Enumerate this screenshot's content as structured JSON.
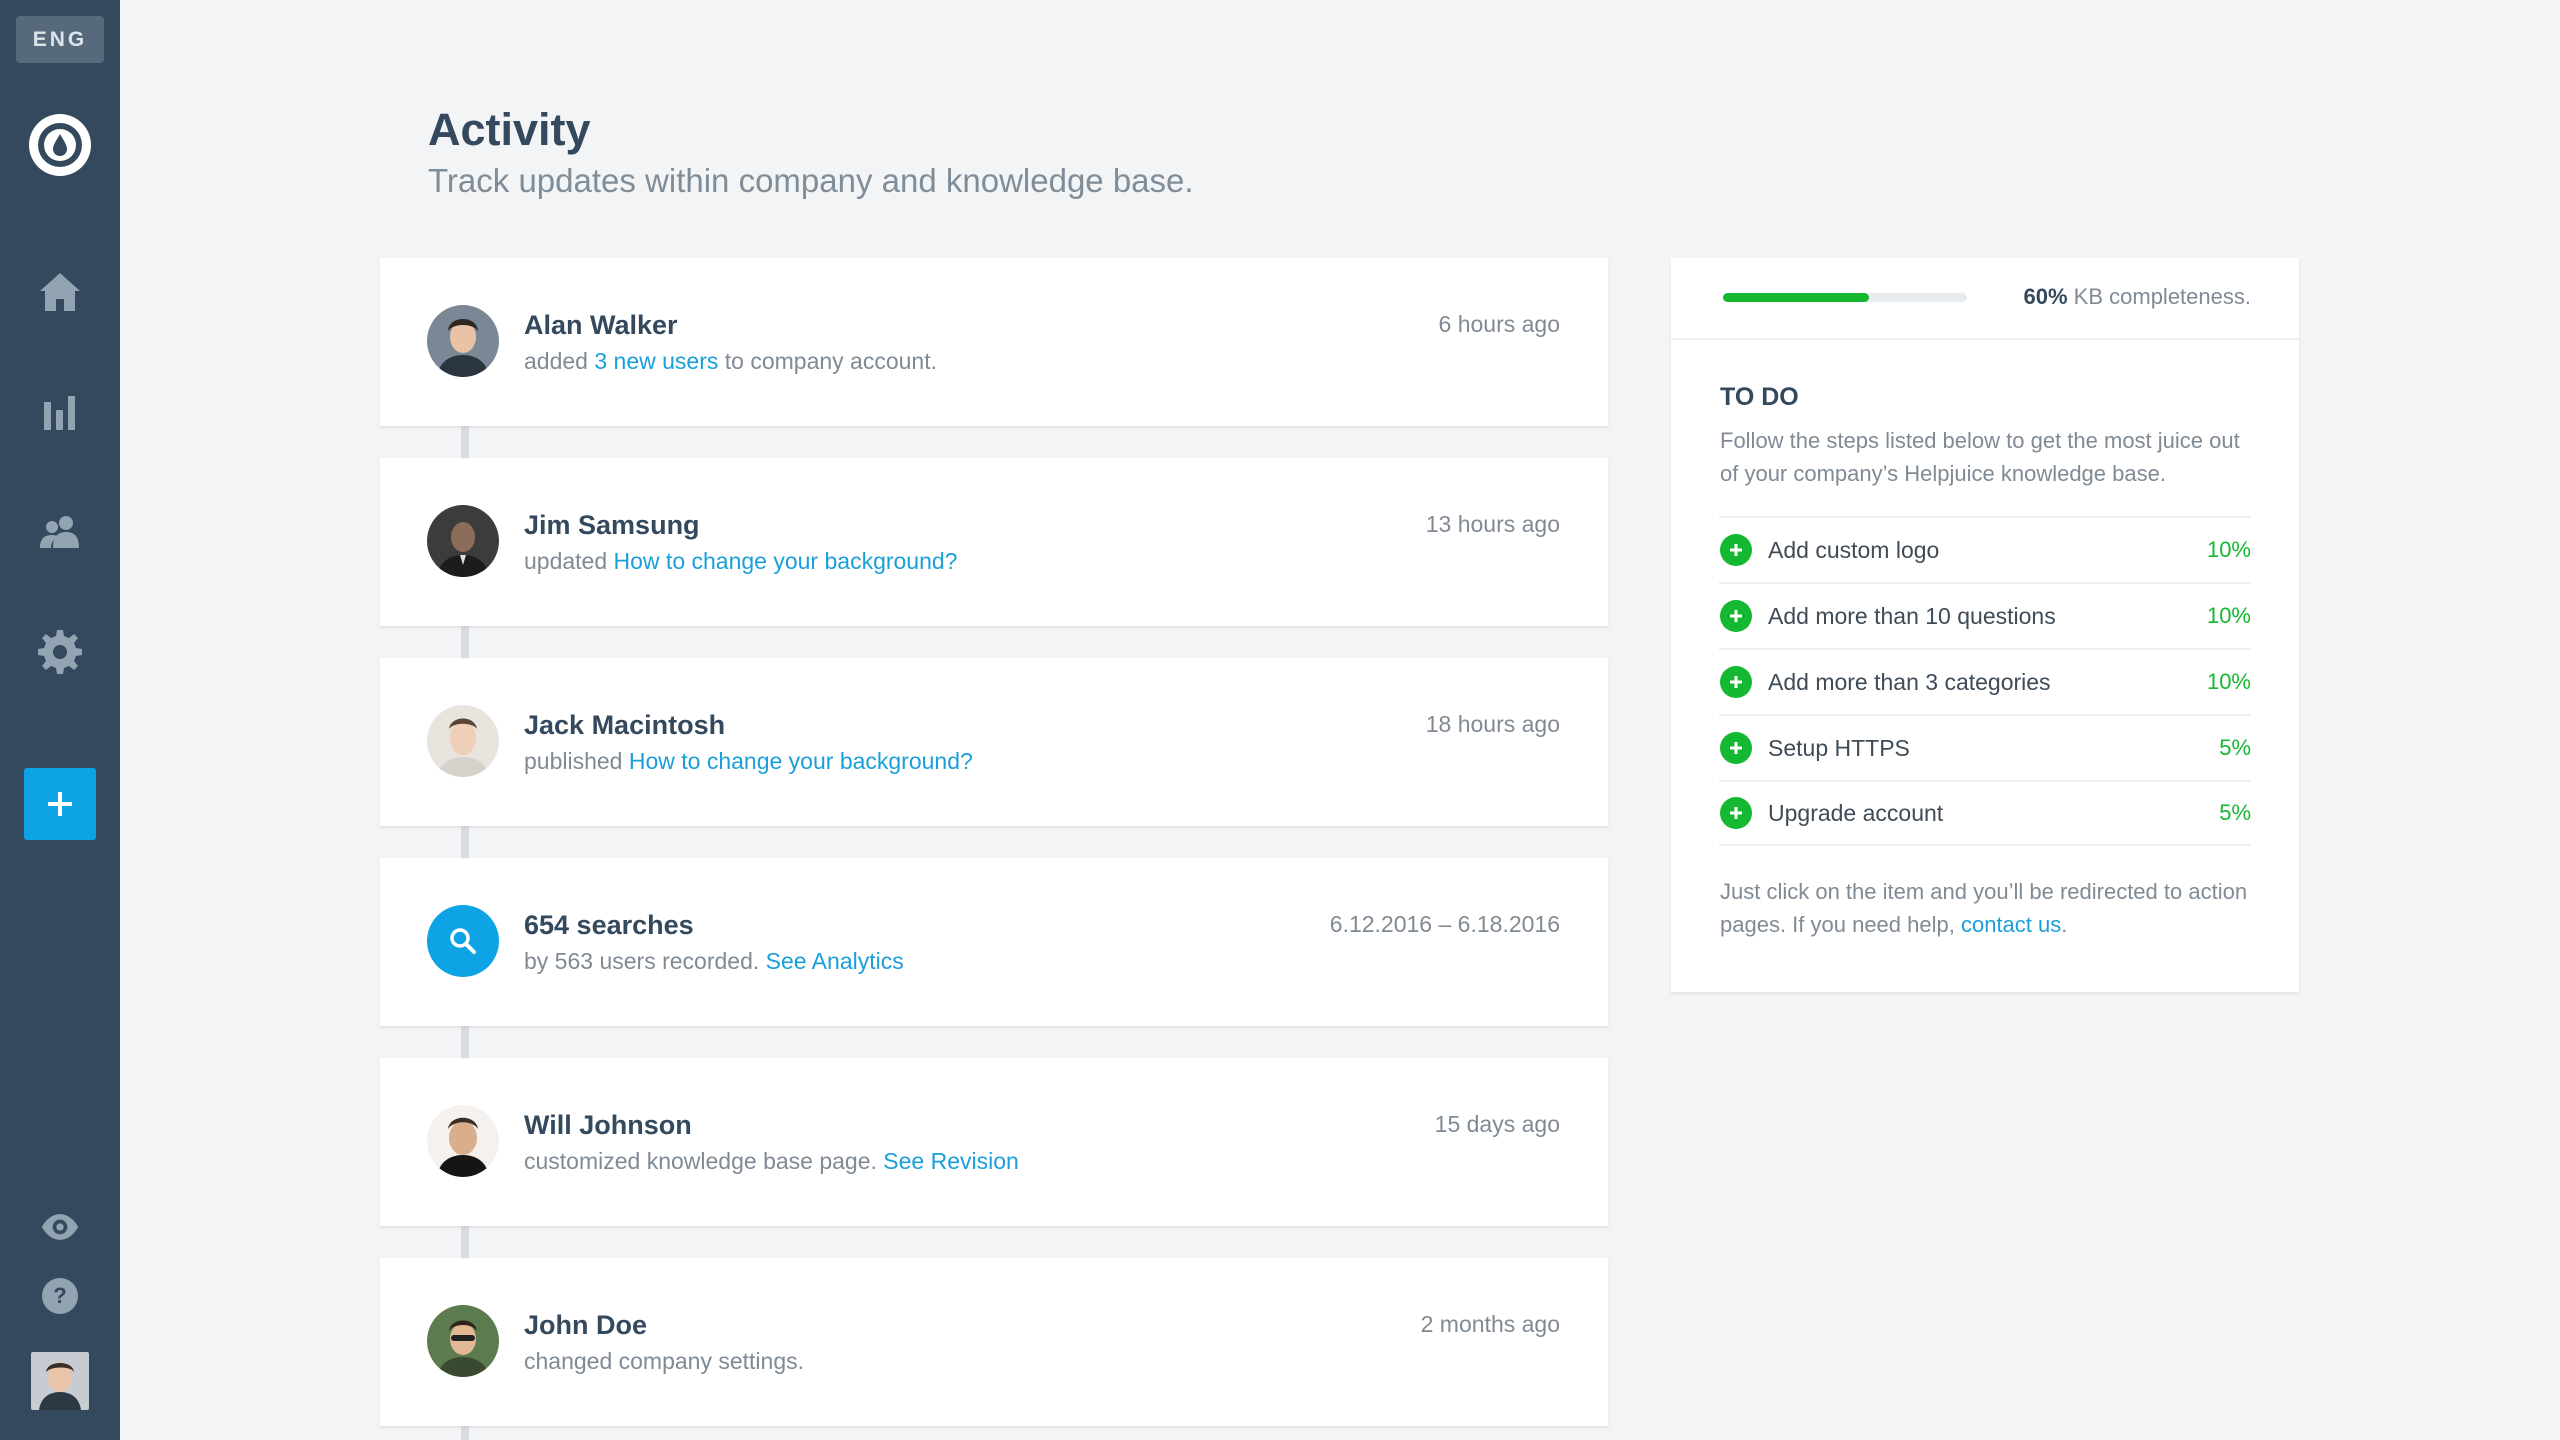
{
  "sidebar": {
    "language": "ENG",
    "icons": [
      "logo-icon",
      "home-icon",
      "analytics-icon",
      "users-icon",
      "settings-icon",
      "plus-icon",
      "eye-icon",
      "help-icon"
    ]
  },
  "header": {
    "title": "Activity",
    "subtitle": "Track updates within company and knowledge base."
  },
  "activities": [
    {
      "name": "Alan Walker",
      "desc_before": "added ",
      "link": "3 new users",
      "desc_after": " to company account.",
      "time": "6 hours ago"
    },
    {
      "name": "Jim Samsung",
      "desc_before": "updated ",
      "link": "How to change your background?",
      "desc_after": "",
      "time": "13 hours ago"
    },
    {
      "name": "Jack Macintosh",
      "desc_before": "published ",
      "link": "How to change your background?",
      "desc_after": "",
      "time": "18 hours ago"
    },
    {
      "name": "654 searches",
      "desc_before": "by 563 users recorded. ",
      "link": "See Analytics",
      "desc_after": "",
      "time": "6.12.2016 – 6.18.2016"
    },
    {
      "name": "Will Johnson",
      "desc_before": "customized knowledge base page. ",
      "link": "See Revision",
      "desc_after": "",
      "time": "15 days ago"
    },
    {
      "name": "John Doe",
      "desc_before": "changed company settings.",
      "link": "",
      "desc_after": "",
      "time": "2 months ago"
    }
  ],
  "panel": {
    "progress": 0.6,
    "progress_pct": "60%",
    "progress_label": " KB completeness.",
    "todo_title": "TO DO",
    "todo_desc": "Follow the steps listed below to get the most juice out of your company’s Helpjuice knowledge base.",
    "items": [
      {
        "label": "Add custom logo",
        "pct": "10%"
      },
      {
        "label": "Add more than 10 questions",
        "pct": "10%"
      },
      {
        "label": "Add more than 3 categories",
        "pct": "10%"
      },
      {
        "label": "Setup HTTPS",
        "pct": "5%"
      },
      {
        "label": "Upgrade account",
        "pct": "5%"
      }
    ],
    "footer_text": "Just click on the item and you’ll be redirected to action pages. If you need help, ",
    "footer_link": "contact us",
    "footer_end": "."
  },
  "colors": {
    "sidebar": "#34495e",
    "accent": "#0ea3e4",
    "success": "#14b831",
    "link": "#1a9fdb"
  }
}
